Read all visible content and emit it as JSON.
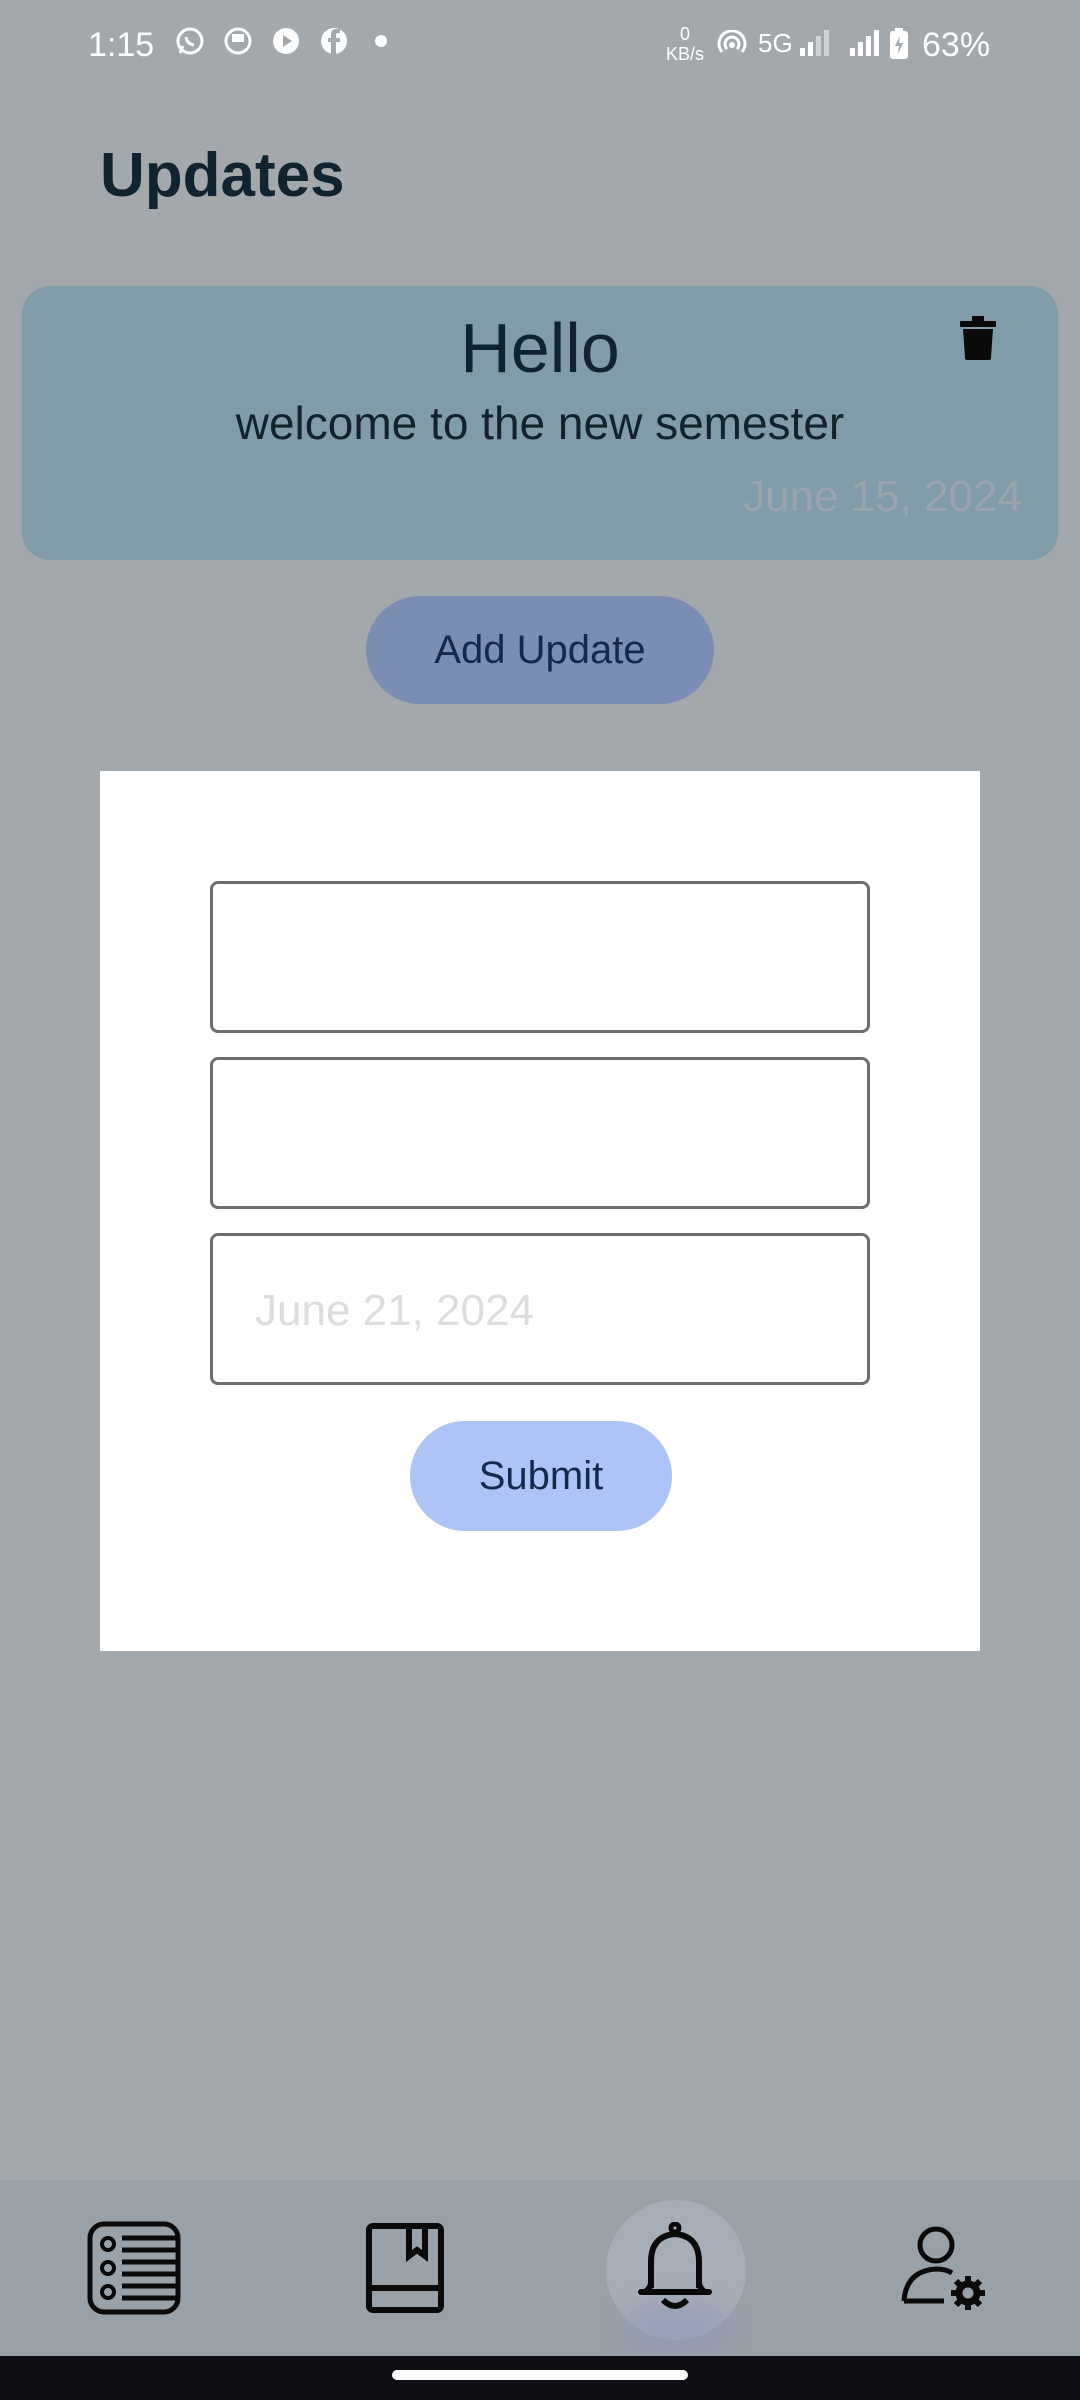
{
  "status_bar": {
    "time": "1:15",
    "net_speed_value": "0",
    "net_speed_unit": "KB/s",
    "network_type": "5G",
    "battery": "63%",
    "notification_icons": [
      "whatsapp-icon",
      "app-icon",
      "youtube-icon",
      "facebook-icon"
    ]
  },
  "header": {
    "title": "Updates"
  },
  "updates": [
    {
      "title": "Hello",
      "body": "welcome to the new semester",
      "date": "June 15, 2024"
    }
  ],
  "add_update_label": "Add Update",
  "form": {
    "title_value": "",
    "description_value": "",
    "date_placeholder": "June 21, 2024",
    "submit_label": "Submit"
  },
  "bottom_nav": {
    "items": [
      "list-icon",
      "book-icon",
      "bell-icon",
      "user-settings-icon"
    ],
    "active": "bell-icon"
  },
  "colors": {
    "background": "#a2a8ac",
    "card": "#819ca9",
    "add_button": "#7c8db3",
    "submit_button": "#aec4f7"
  }
}
